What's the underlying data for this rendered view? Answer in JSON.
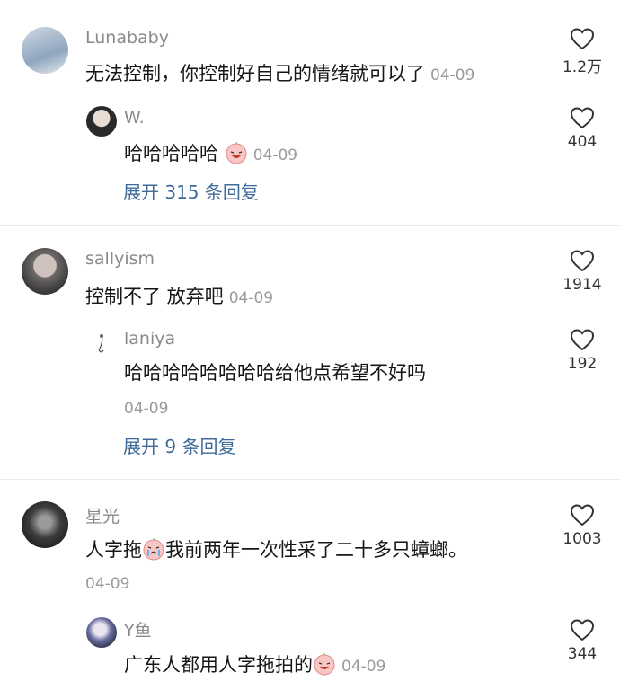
{
  "threads": [
    {
      "top": {
        "name": "Lunababy",
        "text": "无法控制，你控制好自己的情绪就可以了",
        "date": "04-09",
        "likes": "1.2万"
      },
      "reply": {
        "name": "W.",
        "text": "哈哈哈哈哈",
        "date": "04-09",
        "likes": "404"
      },
      "expand": "展开 315 条回复"
    },
    {
      "top": {
        "name": "sallyism",
        "text": "控制不了 放弃吧",
        "date": "04-09",
        "likes": "1914"
      },
      "reply": {
        "name": "laniya",
        "text": "哈哈哈哈哈哈哈哈给他点希望不好吗",
        "date": "04-09",
        "likes": "192"
      },
      "expand": "展开 9 条回复"
    },
    {
      "top": {
        "name": "星光",
        "text_a": "人字拖",
        "text_b": "我前两年一次性采了二十多只蟑螂。",
        "date": "04-09",
        "likes": "1003"
      },
      "reply": {
        "name": "Y鱼",
        "text": "广东人都用人字拖拍的",
        "date": "04-09",
        "likes": "344"
      }
    }
  ],
  "icons": {
    "like": "heart-outline-icon",
    "emoji_laugh": "peach-laugh-emoji",
    "emoji_cry": "peach-cry-emoji"
  },
  "colors": {
    "expand_link": "#3f6b9a",
    "name": "#8a8a8a",
    "date": "#9a9a9a"
  }
}
